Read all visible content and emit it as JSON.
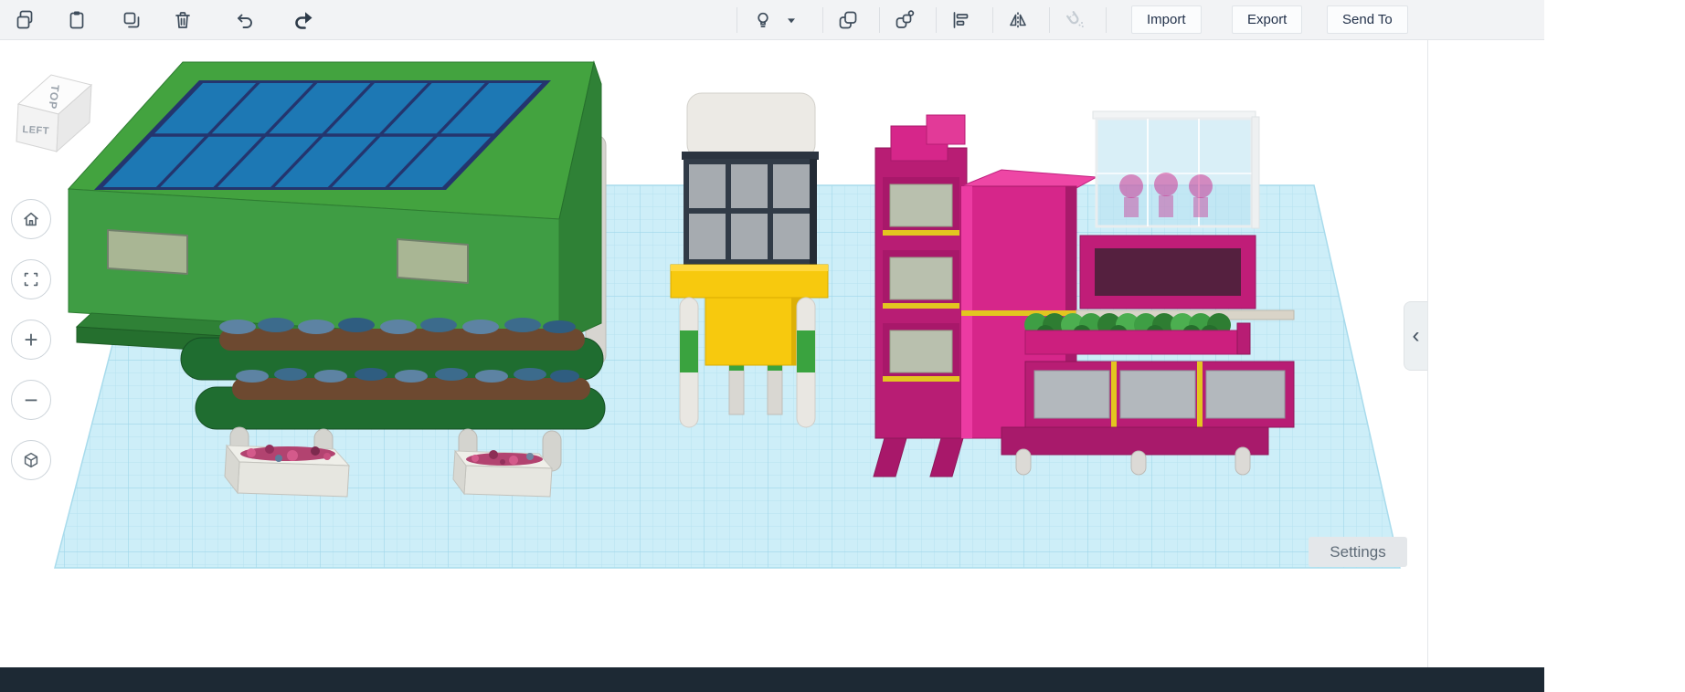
{
  "toolbar": {
    "left_icons": [
      "copy",
      "paste",
      "duplicate",
      "delete",
      "undo",
      "redo"
    ],
    "middle_icons": [
      "toggle-visibility",
      "visibility-options",
      "group",
      "ungroup",
      "align",
      "mirror",
      "snap-magnet"
    ],
    "buttons": {
      "import": "Import",
      "export": "Export",
      "send_to": "Send To"
    }
  },
  "viewcube": {
    "top_label": "TOP",
    "left_label": "LEFT"
  },
  "view_controls": {
    "items": [
      "home-view",
      "fit-view",
      "zoom-in",
      "zoom-out",
      "perspective-toggle"
    ],
    "zoom_in_glyph": "+",
    "zoom_out_glyph": "−"
  },
  "right_panel": {
    "toggle_glyph": "‹"
  },
  "canvas": {
    "settings_label": "Settings"
  },
  "colors": {
    "toolbar_bg": "#f2f3f5",
    "icon": "#3e4c5b",
    "workplane": "#cdeef8",
    "grid_minor": "#b6e2f0",
    "grid_major": "#9fd6e9",
    "building_green": "#3f9d44",
    "solar_blue": "#1d78b4",
    "solar_frame": "#24356e",
    "tower_yellow": "#f7c90e",
    "building_magenta": "#cc1f7e",
    "bottom_bar": "#1d2934"
  }
}
